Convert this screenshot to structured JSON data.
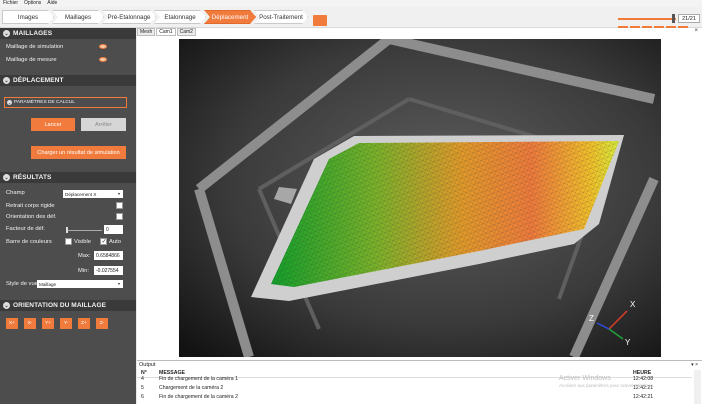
{
  "menubar": {
    "items": [
      "Fichier",
      "Options",
      "Aide"
    ]
  },
  "workflow": {
    "steps": [
      "Images",
      "Maillages",
      "Pré-Etalonnage",
      "Etalonnage",
      "Déplacement",
      "Post-Traitement"
    ],
    "active_step": "Déplacement"
  },
  "frames": {
    "counter": "21/21",
    "controls": [
      "<<<",
      "<<",
      "<",
      ">",
      ">>",
      ">>>"
    ]
  },
  "sections": {
    "maillages": {
      "title": "MAILLAGES",
      "rows": [
        "Maillage de simulation",
        "Maillage de mesure"
      ]
    },
    "deplacement": {
      "title": "DÉPLACEMENT",
      "params_label": "PARAMÈTRES DE CALCUL",
      "run_label": "Lancer",
      "stop_label": "Arrêter",
      "load_label": "Charger un résultat de simulation"
    },
    "resultats": {
      "title": "RÉSULTATS",
      "champ_label": "Champ",
      "champ_value": "Déplacement X",
      "rigid_label": "Retrait corps rigide",
      "orient_label": "Orientation des déf.",
      "factor_label": "Facteur de déf.",
      "factor_value": "0",
      "colorbar_label": "Barre de couleurs",
      "visible_label": "Visible",
      "auto_label": "Auto",
      "max_label": "Max:",
      "max_value": "0.6584866",
      "min_label": "Min:",
      "min_value": "-0.027554",
      "style_label": "Style de vue",
      "style_value": "Maillage"
    },
    "orientation": {
      "title": "ORIENTATION DU MAILLAGE",
      "buttons": [
        "X+",
        "X-",
        "Y+",
        "Y-",
        "Z+",
        "Z-"
      ]
    }
  },
  "view": {
    "tabs": [
      "Mesh",
      "Cam1",
      "Cam2"
    ],
    "selected_tab": "Cam1",
    "close_glyph": "×",
    "axes": {
      "x": "X",
      "y": "Y",
      "z": "Z"
    }
  },
  "output": {
    "title": "Output",
    "controls": "▾ ×",
    "headers": {
      "n": "N°",
      "message": "MESSAGE",
      "time": "HEURE"
    },
    "rows": [
      {
        "n": "4",
        "message": "Fin de chargement de la caméra 1",
        "time": "12:42:08"
      },
      {
        "n": "5",
        "message": "Chargement de la caméra 2",
        "time": "12:42:21"
      },
      {
        "n": "6",
        "message": "Fin de chargement de la caméra 2",
        "time": "12:42:21"
      }
    ],
    "watermark_title": "Activer Windows",
    "watermark_sub": "Accédez aux paramètres pour activer Windows."
  },
  "colors": {
    "accent": "#f07b3c",
    "panel": "#4d4d4d",
    "panel_header": "#3a3a3a"
  }
}
